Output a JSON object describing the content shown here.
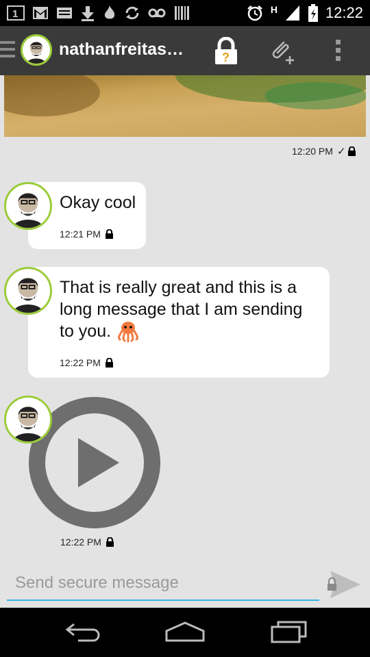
{
  "status_bar": {
    "time": "12:22",
    "network": "H",
    "icons": [
      "sim-1-icon",
      "gmail-icon",
      "keyboard-icon",
      "download-icon",
      "fire-icon",
      "sync-icon",
      "voicemail-icon",
      "barcode-icon",
      "alarm-icon",
      "signal-icon",
      "battery-icon"
    ]
  },
  "action_bar": {
    "contact_name": "nathanfreitas…",
    "icons": [
      "drawer-icon",
      "avatar",
      "lock-question-icon",
      "attach-add-icon",
      "overflow-menu-icon"
    ]
  },
  "messages": [
    {
      "type": "image",
      "timestamp": "12:20 PM",
      "delivered_mark": "✓"
    },
    {
      "type": "text",
      "text": "Okay cool",
      "timestamp": "12:21 PM"
    },
    {
      "type": "text",
      "text_lines": [
        "That is really great and this is a",
        "long message that I am sending",
        "to you."
      ],
      "emoji": "octopus-emoji",
      "timestamp": "12:22 PM"
    },
    {
      "type": "audio",
      "timestamp": "12:22 PM"
    }
  ],
  "composer": {
    "placeholder": "Send secure message"
  },
  "colors": {
    "action_bar": "#3a3a3a",
    "background": "#e3e3e3",
    "avatar_ring": "#9ccc3a",
    "input_underline": "#33b5e5",
    "octopus": "#f27a3f"
  }
}
